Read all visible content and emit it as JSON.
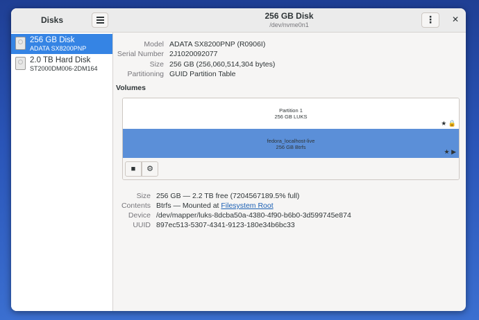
{
  "sidebar": {
    "title": "Disks",
    "menu_icon": "hamburger-icon",
    "drives": [
      {
        "name": "256 GB Disk",
        "model": "ADATA SX8200PNP",
        "selected": true
      },
      {
        "name": "2.0 TB Hard Disk",
        "model": "ST2000DM006-2DM164",
        "selected": false
      }
    ]
  },
  "header": {
    "title": "256 GB Disk",
    "subtitle": "/dev/nvme0n1",
    "menu_label": "⋮",
    "close_label": "✕"
  },
  "disk_info": [
    {
      "label": "Model",
      "value": "ADATA SX8200PNP (R0906I)"
    },
    {
      "label": "Serial Number",
      "value": "2J1020092077"
    },
    {
      "label": "Size",
      "value": "256 GB (256,060,514,304 bytes)"
    },
    {
      "label": "Partitioning",
      "value": "GUID Partition Table"
    }
  ],
  "volumes": {
    "title": "Volumes",
    "partition1": {
      "name": "Partition 1",
      "detail": "256 GB LUKS",
      "marks": "★ 🔒"
    },
    "partition2": {
      "name": "fedora_localhost-live",
      "detail": "256 GB Btrfs",
      "marks": "★ ▶"
    },
    "toolbar": {
      "stop_label": "■",
      "settings_label": "⚙"
    }
  },
  "volume_info": {
    "size_label": "Size",
    "size_value": "256 GB — 2.2 TB free (7204567189.5% full)",
    "contents_label": "Contents",
    "contents_prefix": "Btrfs — Mounted at ",
    "contents_link": "Filesystem Root",
    "device_label": "Device",
    "device_value": "/dev/mapper/luks-8dcba50a-4380-4f90-b6b0-3d599745e874",
    "uuid_label": "UUID",
    "uuid_value": "897ec513-5307-4341-9123-180e34b6bc33"
  },
  "colors": {
    "accent": "#3584e4",
    "selected_volume": "#5b8fd8",
    "link": "#1a5fb4"
  }
}
